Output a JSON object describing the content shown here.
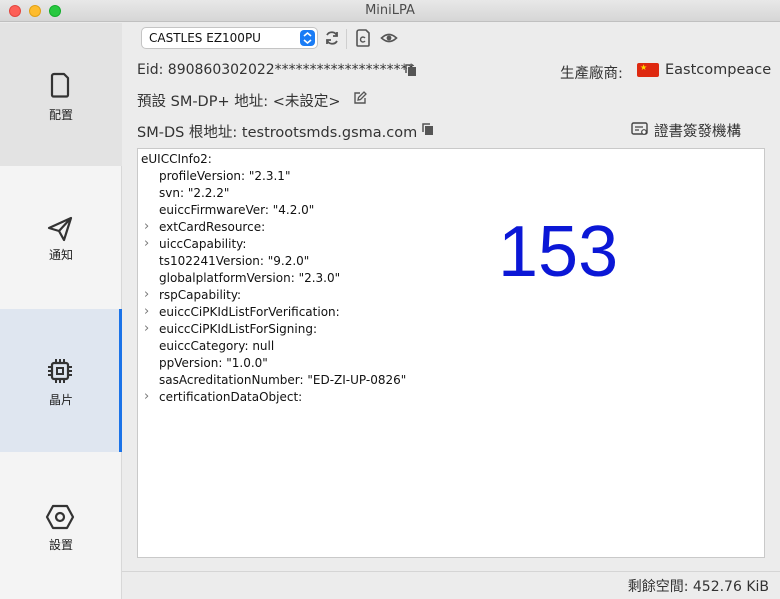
{
  "window": {
    "title": "MiniLPA"
  },
  "sidebar": {
    "items": [
      {
        "label": "配置",
        "icon": "profile-card-icon"
      },
      {
        "label": "通知",
        "icon": "paper-plane-icon"
      },
      {
        "label": "晶片",
        "icon": "chip-icon"
      },
      {
        "label": "設置",
        "icon": "gear-hex-icon"
      }
    ],
    "active_index": 2
  },
  "toolbar": {
    "device": "CASTLES EZ100PU",
    "icons": [
      "refresh-icon",
      "sim-card-icon",
      "eye-icon"
    ]
  },
  "info": {
    "eid": "Eid: 890860302022********************",
    "manufacturer_label": "生產廠商:",
    "manufacturer_name": "Eastcompeace",
    "smdp": "預設 SM-DP+ 地址: <未設定>",
    "smds": "SM-DS 根地址: testrootsmds.gsma.com",
    "ci_button": "證書簽發機構"
  },
  "tree": {
    "lines": [
      {
        "text": "eUICCInfo2:",
        "level": 0,
        "expandable": false
      },
      {
        "text": "profileVersion: \"2.3.1\"",
        "level": 1,
        "expandable": false
      },
      {
        "text": "svn: \"2.2.2\"",
        "level": 1,
        "expandable": false
      },
      {
        "text": "euiccFirmwareVer: \"4.2.0\"",
        "level": 1,
        "expandable": false
      },
      {
        "text": "extCardResource:",
        "level": 1,
        "expandable": true
      },
      {
        "text": "uiccCapability:",
        "level": 1,
        "expandable": true
      },
      {
        "text": "ts102241Version: \"9.2.0\"",
        "level": 1,
        "expandable": false
      },
      {
        "text": "globalplatformVersion: \"2.3.0\"",
        "level": 1,
        "expandable": false
      },
      {
        "text": "rspCapability:",
        "level": 1,
        "expandable": true
      },
      {
        "text": "euiccCiPKIdListForVerification:",
        "level": 1,
        "expandable": true
      },
      {
        "text": "euiccCiPKIdListForSigning:",
        "level": 1,
        "expandable": true
      },
      {
        "text": "euiccCategory: null",
        "level": 1,
        "expandable": false
      },
      {
        "text": "ppVersion: \"1.0.0\"",
        "level": 1,
        "expandable": false
      },
      {
        "text": "sasAcreditationNumber: \"ED-ZI-UP-0826\"",
        "level": 1,
        "expandable": false
      },
      {
        "text": "certificationDataObject:",
        "level": 1,
        "expandable": true
      }
    ],
    "overlay_number": "153"
  },
  "status": {
    "free_space": "剩餘空間: 452.76 KiB"
  },
  "colors": {
    "accent": "#1b73e8",
    "overlay": "#0b17d6"
  }
}
